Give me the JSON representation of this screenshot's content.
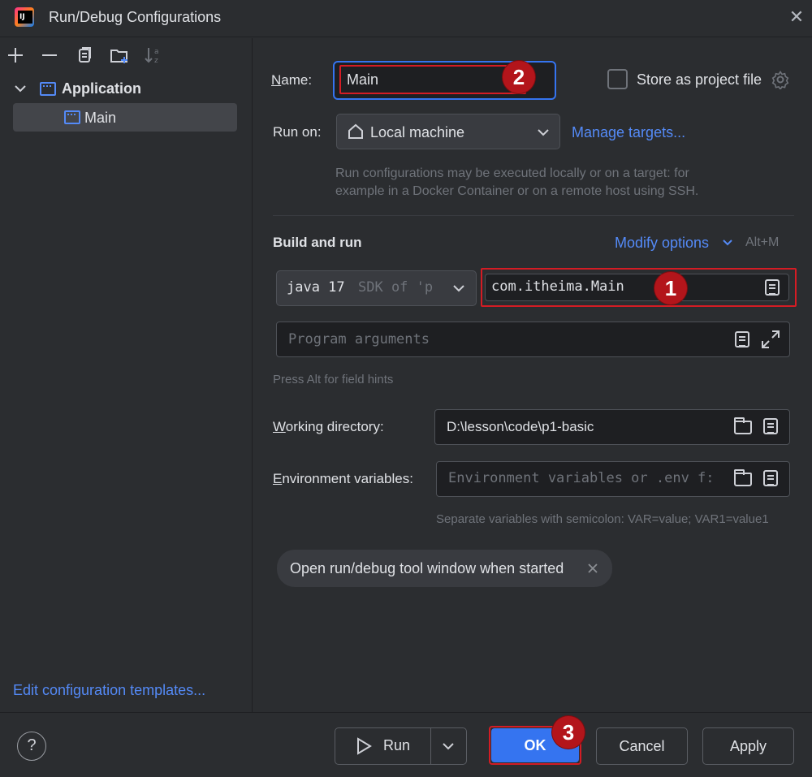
{
  "window": {
    "title": "Run/Debug Configurations"
  },
  "left": {
    "tree": {
      "group_label": "Application",
      "item_label": "Main"
    },
    "templates_link": "Edit configuration templates..."
  },
  "form": {
    "name_label_prefix": "N",
    "name_label_rest": "ame:",
    "name_value": "Main",
    "store_label": "Store as project file",
    "run_on_label": "Run on:",
    "run_on_value": "Local machine",
    "manage_targets": "Manage targets...",
    "run_on_hint_line1": "Run configurations may be executed locally or on a target: for",
    "run_on_hint_line2": "example in a Docker Container or on a remote host using SSH.",
    "build_run_title": "Build and run",
    "modify_options": "Modify options",
    "modify_shortcut": "Alt+M",
    "jdk_main": "java 17",
    "jdk_sub": "SDK of 'p",
    "main_class": "com.itheima.Main",
    "program_args_placeholder": "Program arguments",
    "field_hint": "Press Alt for field hints",
    "working_dir_label_prefix": "W",
    "working_dir_label_rest": "orking directory:",
    "working_dir_value": "D:\\lesson\\code\\p1-basic",
    "env_label_prefix": "E",
    "env_label_rest": "nvironment variables:",
    "env_placeholder": "Environment variables or .env f:",
    "env_hint": "Separate variables with semicolon: VAR=value; VAR1=value1",
    "chip_label": "Open run/debug tool window when started"
  },
  "annotations": {
    "badge1": "1",
    "badge2": "2",
    "badge3": "3",
    "color": "#b3151b"
  },
  "buttons": {
    "help": "?",
    "run": "Run",
    "ok": "OK",
    "cancel": "Cancel",
    "apply": "Apply"
  },
  "colors": {
    "accent": "#548af7",
    "primary_button": "#3574f0",
    "background": "#2b2d30",
    "field_bg": "#1e1f22"
  }
}
